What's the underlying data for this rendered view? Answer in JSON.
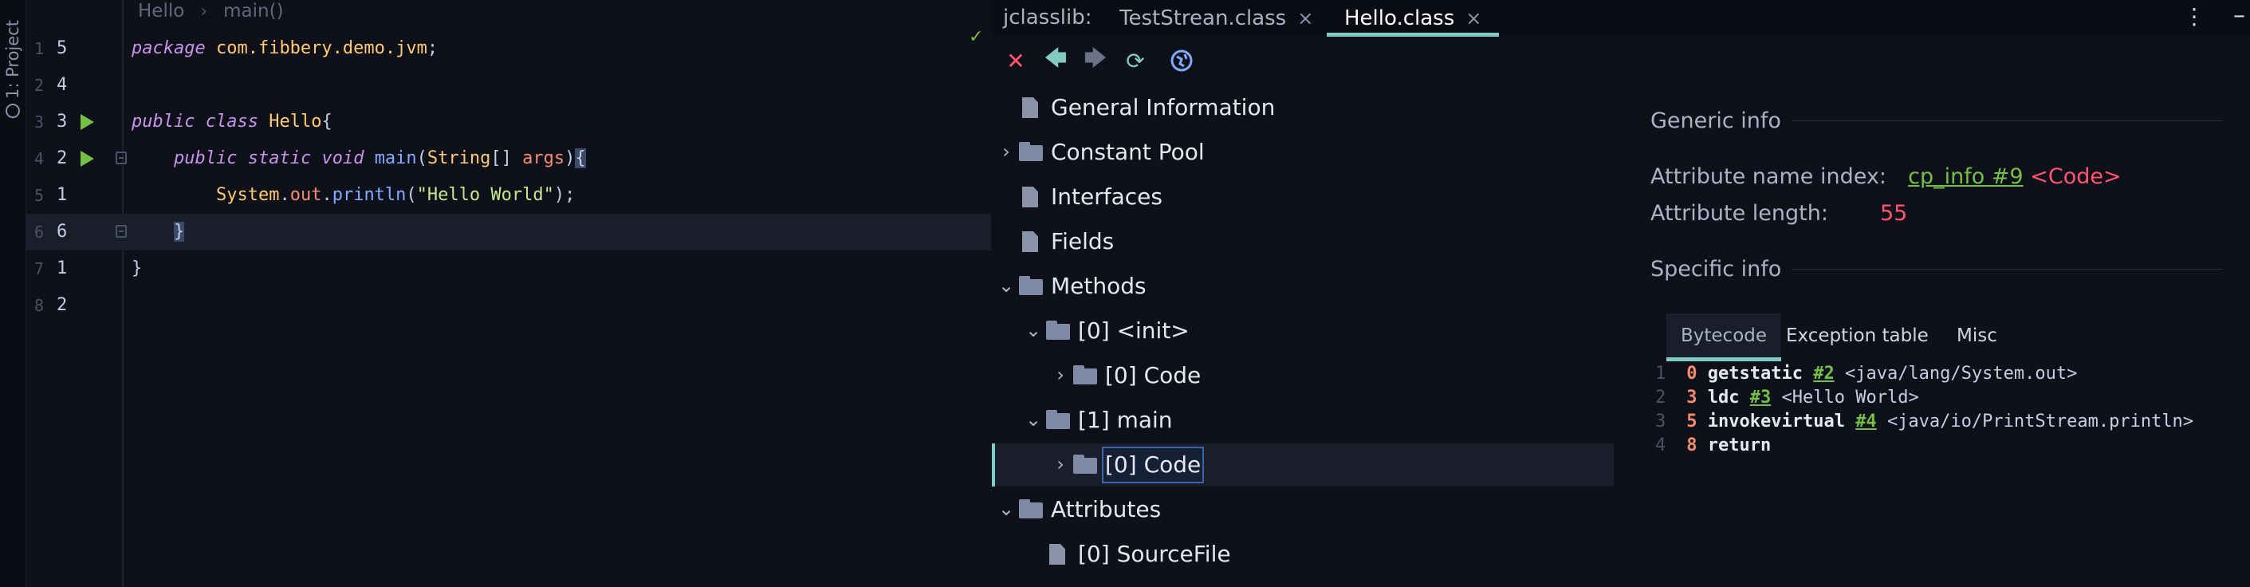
{
  "sidebar": {
    "project_label": "1: Project"
  },
  "editor": {
    "breadcrumb": [
      "Hello",
      "main()"
    ],
    "lines": [
      {
        "rel": "1",
        "abs": "5"
      },
      {
        "rel": "2",
        "abs": "4"
      },
      {
        "rel": "3",
        "abs": "3"
      },
      {
        "rel": "4",
        "abs": "2"
      },
      {
        "rel": "5",
        "abs": "1"
      },
      {
        "rel": "6",
        "abs": "6"
      },
      {
        "rel": "7",
        "abs": "1"
      },
      {
        "rel": "8",
        "abs": "2"
      }
    ],
    "code": {
      "l1_kw": "package",
      "l1_pkg": "com.fibbery.demo.jvm",
      "l1_semi": ";",
      "l3_kw1": "public",
      "l3_kw2": "class",
      "l3_name": "Hello",
      "l3_brace": "{",
      "l4_kw1": "public",
      "l4_kw2": "static",
      "l4_kw3": "void",
      "l4_fn": "main",
      "l4_lp": "(",
      "l4_type": "String",
      "l4_arr": "[]",
      "l4_param": "args",
      "l4_rp": ")",
      "l4_brace": "{",
      "l5_cls": "System",
      "l5_dot1": ".",
      "l5_fld": "out",
      "l5_dot2": ".",
      "l5_fn": "println",
      "l5_lp": "(",
      "l5_str": "\"Hello World\"",
      "l5_rp": ")",
      "l5_semi": ";",
      "l6_brace": "}",
      "l7_brace": "}"
    },
    "status_icon": "check-icon"
  },
  "jclasslib": {
    "title": "jclasslib:",
    "tabs": [
      {
        "label": "TestStrean.class",
        "close": "×"
      },
      {
        "label": "Hello.class",
        "close": "×"
      }
    ],
    "toolbar_icons": [
      "close-icon",
      "back-arrow-icon",
      "forward-arrow-icon",
      "refresh-icon",
      "web-icon"
    ],
    "tree": [
      {
        "label": "General Information",
        "icon": "file-icon"
      },
      {
        "label": "Constant Pool",
        "icon": "folder-icon",
        "arrow": "›"
      },
      {
        "label": "Interfaces",
        "icon": "file-icon"
      },
      {
        "label": "Fields",
        "icon": "file-icon"
      },
      {
        "label": "Methods",
        "icon": "folder-icon",
        "arrow": "⌄"
      },
      {
        "label": "[0] <init>",
        "icon": "folder-icon",
        "arrow": "⌄"
      },
      {
        "label": "[0] Code",
        "icon": "folder-icon",
        "arrow": "›"
      },
      {
        "label": "[1] main",
        "icon": "folder-icon",
        "arrow": "⌄"
      },
      {
        "label": "[0] Code",
        "icon": "folder-icon",
        "arrow": "›",
        "selected": true
      },
      {
        "label": "Attributes",
        "icon": "folder-icon",
        "arrow": "⌄"
      },
      {
        "label": "[0] SourceFile",
        "icon": "file-icon"
      }
    ],
    "detail": {
      "generic_title": "Generic info",
      "attr_name_label": "Attribute name index:",
      "attr_name_link": "cp_info #9",
      "attr_name_value": "<Code>",
      "attr_length_label": "Attribute length:",
      "attr_length_value": "55",
      "specific_title": "Specific info",
      "sub_tabs": [
        "Bytecode",
        "Exception table",
        "Misc"
      ],
      "bytecode": [
        {
          "ln": "1",
          "off": "0",
          "op": "getstatic",
          "ref": "#2",
          "cmt": "<java/lang/System.out>"
        },
        {
          "ln": "2",
          "off": "3",
          "op": "ldc",
          "ref": "#3",
          "cmt": "<Hello World>"
        },
        {
          "ln": "3",
          "off": "5",
          "op": "invokevirtual",
          "ref": "#4",
          "cmt": "<java/io/PrintStream.println>"
        },
        {
          "ln": "4",
          "off": "8",
          "op": "return",
          "ref": "",
          "cmt": ""
        }
      ]
    }
  },
  "colors": {
    "background": "#0f111a",
    "accent": "#80cbc4",
    "keyword": "#c792ea",
    "link_green": "#74c043",
    "error_red": "#ff5370"
  }
}
